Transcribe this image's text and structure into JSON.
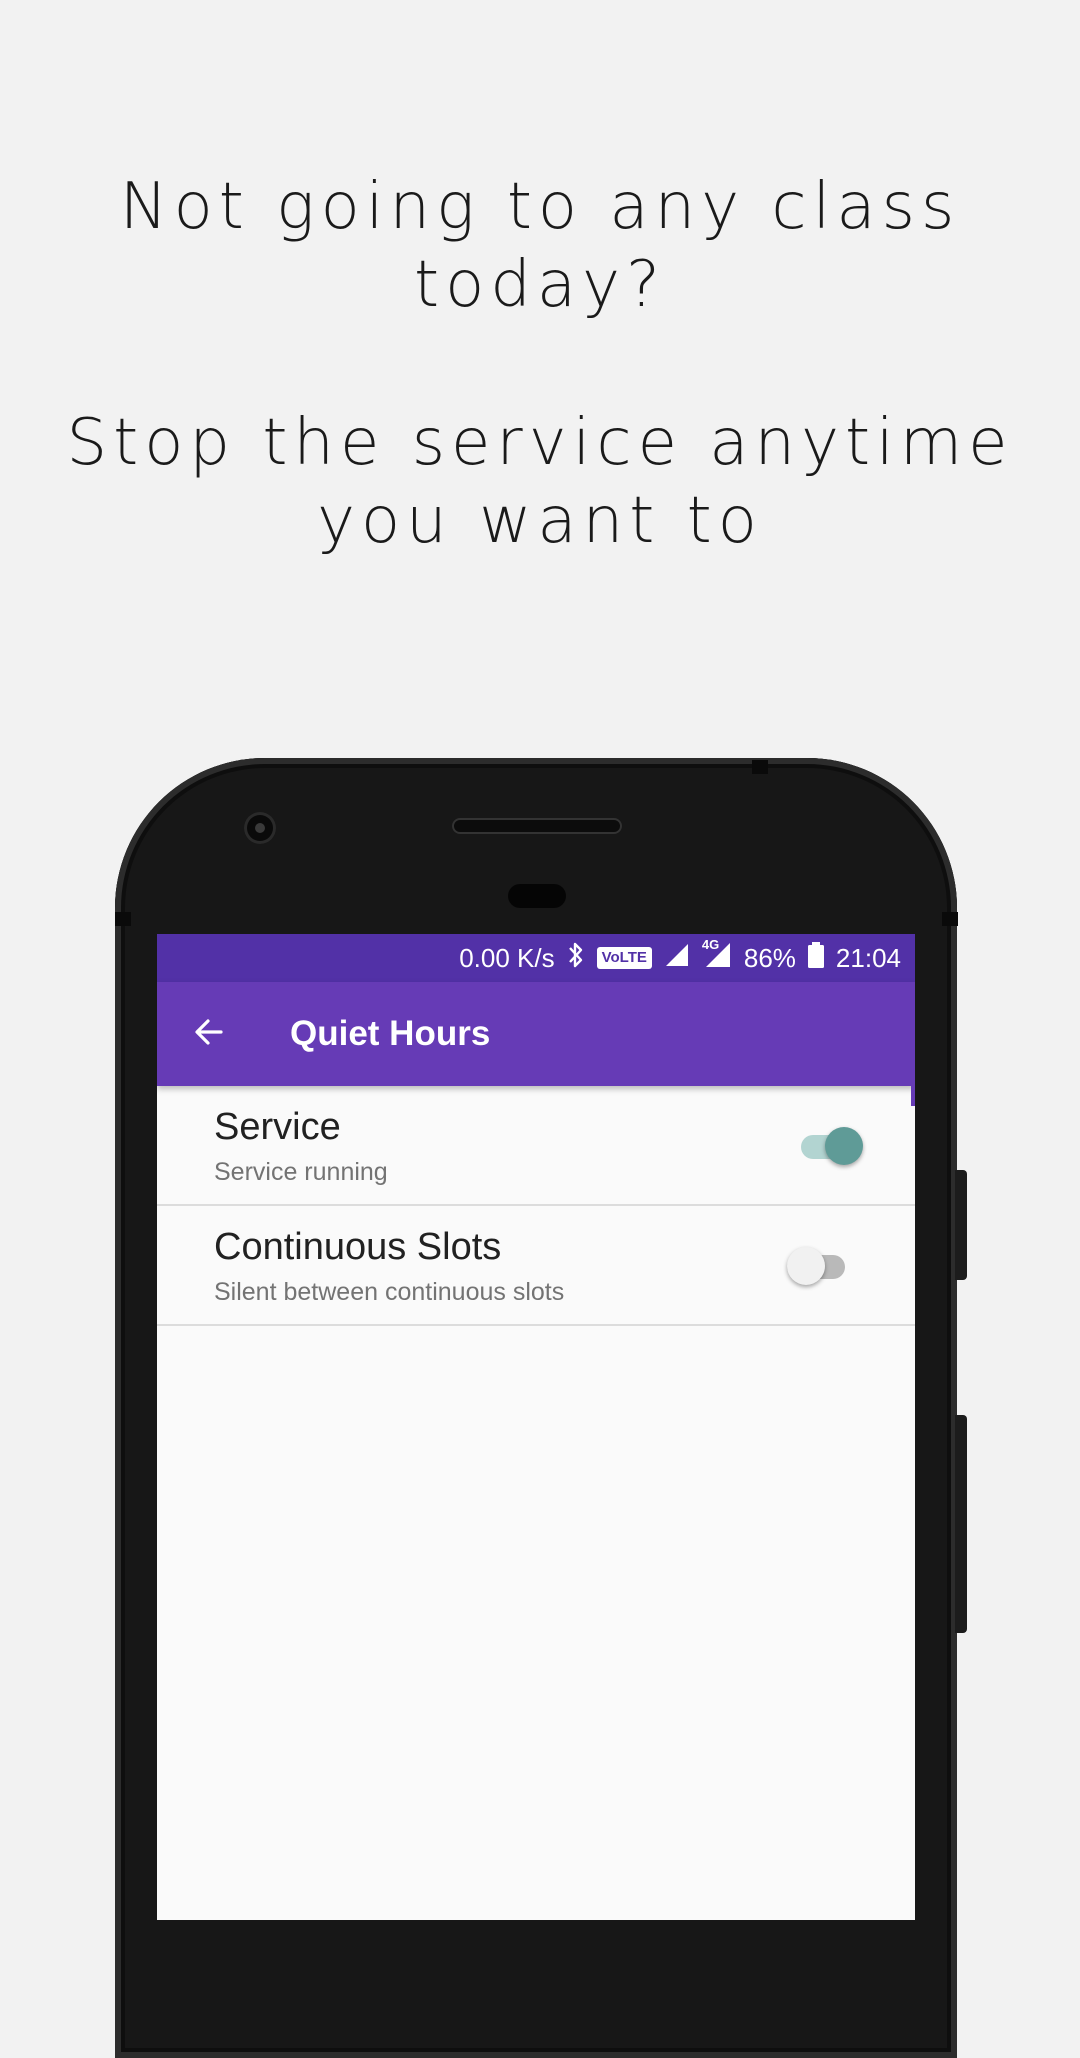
{
  "promo": {
    "line1a": "Not going to any class",
    "line1b": "today?",
    "line2a": "Stop the service anytime",
    "line2b": "you want to"
  },
  "status_bar": {
    "speed": "0.00 K/s",
    "volte": "VoLTE",
    "network": "4G",
    "battery": "86%",
    "time": "21:04"
  },
  "app_bar": {
    "title": "Quiet Hours",
    "back_icon": "arrow-back-icon"
  },
  "preferences": [
    {
      "title": "Service",
      "summary": "Service running",
      "enabled": true
    },
    {
      "title": "Continuous Slots",
      "summary": "Silent between continuous slots",
      "enabled": false
    }
  ],
  "colors": {
    "status_bar": "#5231a7",
    "app_bar": "#663bb6",
    "switch_on_thumb": "#5f9b97",
    "switch_on_track": "#b2d4d1",
    "switch_off_thumb": "#f1f1f1",
    "switch_off_track": "#b9b9b9"
  }
}
